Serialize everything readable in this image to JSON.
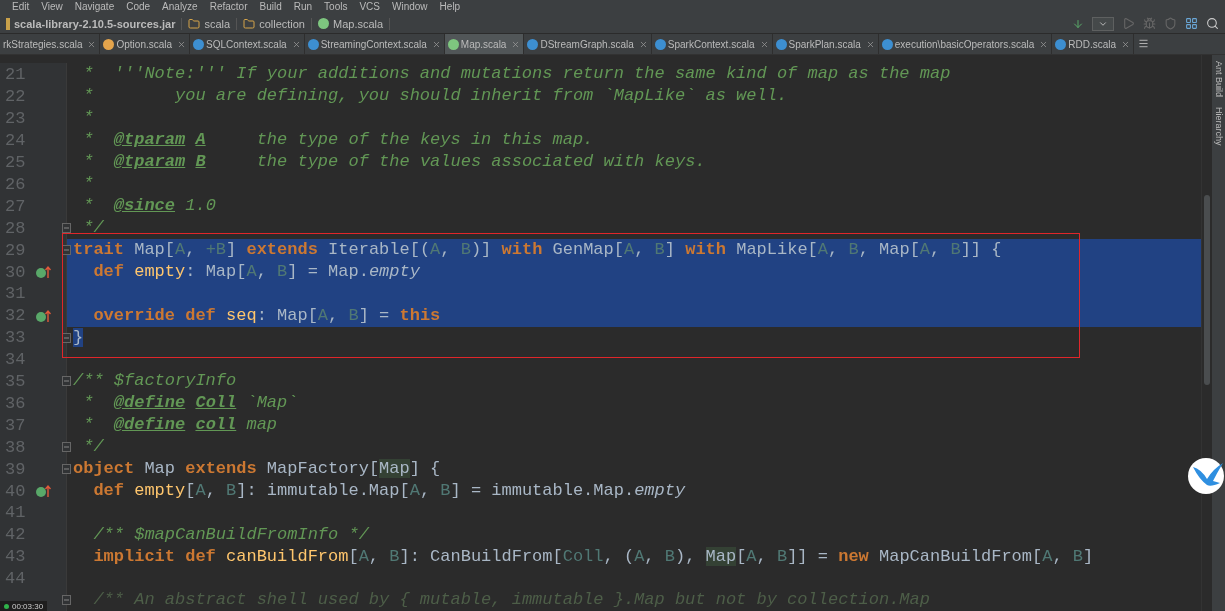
{
  "menu": [
    "Edit",
    "View",
    "Navigate",
    "Code",
    "Analyze",
    "Refactor",
    "Build",
    "Run",
    "Tools",
    "VCS",
    "Window",
    "Help"
  ],
  "breadcrumbs": [
    {
      "kind": "jar",
      "label": "scala-library-2.10.5-sources.jar"
    },
    {
      "kind": "folder",
      "label": "scala"
    },
    {
      "kind": "folder",
      "label": "collection"
    },
    {
      "kind": "trait",
      "label": "Map.scala"
    }
  ],
  "tabs": [
    {
      "kind": "none",
      "label": "rkStrategies.scala",
      "selected": false
    },
    {
      "kind": "object",
      "label": "Option.scala",
      "selected": false
    },
    {
      "kind": "class",
      "label": "SQLContext.scala",
      "selected": false
    },
    {
      "kind": "class",
      "label": "StreamingContext.scala",
      "selected": false
    },
    {
      "kind": "trait",
      "label": "Map.scala",
      "selected": true
    },
    {
      "kind": "class",
      "label": "DStreamGraph.scala",
      "selected": false
    },
    {
      "kind": "class",
      "label": "SparkContext.scala",
      "selected": false
    },
    {
      "kind": "class",
      "label": "SparkPlan.scala",
      "selected": false
    },
    {
      "kind": "class",
      "label": "execution\\basicOperators.scala",
      "selected": false
    },
    {
      "kind": "class",
      "label": "RDD.scala",
      "selected": false
    }
  ],
  "side_tools": [
    "Ant Build",
    "Hierarchy"
  ],
  "lines": [
    {
      "number": "21",
      "marker": false,
      "fold": false,
      "selected": false,
      "tokens": [
        {
          "kind": "doc",
          "text": " *  '''Note:''' If your additions and mutations return the same kind of map as the map"
        }
      ]
    },
    {
      "number": "22",
      "marker": false,
      "fold": false,
      "selected": false,
      "tokens": [
        {
          "kind": "doc",
          "text": " *        you are defining, you should inherit from `MapLike` as well."
        }
      ]
    },
    {
      "number": "23",
      "marker": false,
      "fold": false,
      "selected": false,
      "tokens": [
        {
          "kind": "doc",
          "text": " *"
        }
      ]
    },
    {
      "number": "24",
      "marker": false,
      "fold": false,
      "selected": false,
      "tokens": [
        {
          "kind": "doc",
          "text": " *  "
        },
        {
          "kind": "doctag",
          "text": "@tparam"
        },
        {
          "kind": "doctag",
          "text": " A"
        },
        {
          "kind": "doc",
          "text": "     the type of the keys in this map."
        }
      ]
    },
    {
      "number": "25",
      "marker": false,
      "fold": false,
      "selected": false,
      "tokens": [
        {
          "kind": "doc",
          "text": " *  "
        },
        {
          "kind": "doctag",
          "text": "@tparam"
        },
        {
          "kind": "doctag",
          "text": " B"
        },
        {
          "kind": "doc",
          "text": "     the type of the values associated with keys."
        }
      ]
    },
    {
      "number": "26",
      "marker": false,
      "fold": false,
      "selected": false,
      "tokens": [
        {
          "kind": "doc",
          "text": " *"
        }
      ]
    },
    {
      "number": "27",
      "marker": false,
      "fold": false,
      "selected": false,
      "tokens": [
        {
          "kind": "doc",
          "text": " *  "
        },
        {
          "kind": "doctag",
          "text": "@since"
        },
        {
          "kind": "doc",
          "text": " 1.0"
        }
      ]
    },
    {
      "number": "28",
      "marker": false,
      "fold": true,
      "selected": false,
      "tokens": [
        {
          "kind": "doc",
          "text": " */"
        }
      ]
    },
    {
      "number": "29",
      "marker": false,
      "fold": true,
      "selected": true,
      "tokens": [
        {
          "kind": "kw",
          "text": "trait"
        },
        {
          "kind": "id",
          "text": " Map["
        },
        {
          "kind": "tp",
          "text": "A"
        },
        {
          "kind": "id",
          "text": ", "
        },
        {
          "kind": "tp",
          "text": "+B"
        },
        {
          "kind": "id",
          "text": "] "
        },
        {
          "kind": "kw",
          "text": "extends"
        },
        {
          "kind": "id",
          "text": " Iterable[("
        },
        {
          "kind": "tp",
          "text": "A"
        },
        {
          "kind": "id",
          "text": ", "
        },
        {
          "kind": "tp",
          "text": "B"
        },
        {
          "kind": "id",
          "text": ")] "
        },
        {
          "kind": "kw",
          "text": "with"
        },
        {
          "kind": "id",
          "text": " GenMap["
        },
        {
          "kind": "tp",
          "text": "A"
        },
        {
          "kind": "id",
          "text": ", "
        },
        {
          "kind": "tp",
          "text": "B"
        },
        {
          "kind": "id",
          "text": "] "
        },
        {
          "kind": "kw",
          "text": "with"
        },
        {
          "kind": "id",
          "text": " MapLike["
        },
        {
          "kind": "tp",
          "text": "A"
        },
        {
          "kind": "id",
          "text": ", "
        },
        {
          "kind": "tp",
          "text": "B"
        },
        {
          "kind": "id",
          "text": ", Map["
        },
        {
          "kind": "tp",
          "text": "A"
        },
        {
          "kind": "id",
          "text": ", "
        },
        {
          "kind": "tp",
          "text": "B"
        },
        {
          "kind": "id",
          "text": "]] {"
        }
      ]
    },
    {
      "number": "30",
      "marker": true,
      "fold": false,
      "selected": true,
      "tokens": [
        {
          "kind": "kw",
          "text": "  def"
        },
        {
          "kind": "fn",
          "text": " empty"
        },
        {
          "kind": "id",
          "text": ": Map["
        },
        {
          "kind": "tp",
          "text": "A"
        },
        {
          "kind": "id",
          "text": ", "
        },
        {
          "kind": "tp",
          "text": "B"
        },
        {
          "kind": "id",
          "text": "] = Map."
        },
        {
          "kind": "italic",
          "text": "empty"
        }
      ]
    },
    {
      "number": "31",
      "marker": false,
      "fold": false,
      "selected": true
    },
    {
      "number": "32",
      "marker": true,
      "fold": false,
      "selected": true,
      "tokens": [
        {
          "kind": "kw",
          "text": "  override def"
        },
        {
          "kind": "fn",
          "text": " seq"
        },
        {
          "kind": "id",
          "text": ": Map["
        },
        {
          "kind": "tp",
          "text": "A"
        },
        {
          "kind": "id",
          "text": ", "
        },
        {
          "kind": "tp",
          "text": "B"
        },
        {
          "kind": "id",
          "text": "] = "
        },
        {
          "kind": "kw",
          "text": "this"
        }
      ]
    },
    {
      "number": "33",
      "marker": false,
      "fold": true,
      "selected": false,
      "tokens": [
        {
          "kind": "sel",
          "text": "}"
        }
      ]
    },
    {
      "number": "34",
      "marker": false,
      "fold": false,
      "selected": false
    },
    {
      "number": "35",
      "marker": false,
      "fold": true,
      "selected": false,
      "tokens": [
        {
          "kind": "doc",
          "text": "/** $factoryInfo"
        }
      ]
    },
    {
      "number": "36",
      "marker": false,
      "fold": false,
      "selected": false,
      "tokens": [
        {
          "kind": "doc",
          "text": " *  "
        },
        {
          "kind": "doctag",
          "text": "@define"
        },
        {
          "kind": "doctag",
          "text": " Coll"
        },
        {
          "kind": "doc",
          "text": " `Map`"
        }
      ]
    },
    {
      "number": "37",
      "marker": false,
      "fold": false,
      "selected": false,
      "tokens": [
        {
          "kind": "doc",
          "text": " *  "
        },
        {
          "kind": "doctag",
          "text": "@define"
        },
        {
          "kind": "doctag",
          "text": " coll"
        },
        {
          "kind": "doc",
          "text": " map"
        }
      ]
    },
    {
      "number": "38",
      "marker": false,
      "fold": true,
      "selected": false,
      "tokens": [
        {
          "kind": "doc",
          "text": " */"
        }
      ]
    },
    {
      "number": "39",
      "marker": false,
      "fold": true,
      "selected": false,
      "tokens": [
        {
          "kind": "kw",
          "text": "object"
        },
        {
          "kind": "id",
          "text": " Map "
        },
        {
          "kind": "kw",
          "text": "extends"
        },
        {
          "kind": "id",
          "text": " MapFactory["
        },
        {
          "kind": "match",
          "text": "Map"
        },
        {
          "kind": "id",
          "text": "] {"
        }
      ]
    },
    {
      "number": "40",
      "marker": true,
      "fold": false,
      "selected": false,
      "tokens": [
        {
          "kind": "kw",
          "text": "  def"
        },
        {
          "kind": "fn",
          "text": " empty"
        },
        {
          "kind": "id",
          "text": "["
        },
        {
          "kind": "tp",
          "text": "A"
        },
        {
          "kind": "id",
          "text": ", "
        },
        {
          "kind": "tp",
          "text": "B"
        },
        {
          "kind": "id",
          "text": "]: immutable.Map["
        },
        {
          "kind": "tp",
          "text": "A"
        },
        {
          "kind": "id",
          "text": ", "
        },
        {
          "kind": "tp",
          "text": "B"
        },
        {
          "kind": "id",
          "text": "] = immutable.Map."
        },
        {
          "kind": "italic",
          "text": "empty"
        }
      ]
    },
    {
      "number": "41",
      "marker": false,
      "fold": false,
      "selected": false
    },
    {
      "number": "42",
      "marker": false,
      "fold": false,
      "selected": false,
      "tokens": [
        {
          "kind": "doc",
          "text": "  /** $mapCanBuildFromInfo */"
        }
      ]
    },
    {
      "number": "43",
      "marker": false,
      "fold": false,
      "selected": false,
      "tokens": [
        {
          "kind": "kw",
          "text": "  implicit def"
        },
        {
          "kind": "fn",
          "text": " canBuildFrom"
        },
        {
          "kind": "id",
          "text": "["
        },
        {
          "kind": "tp",
          "text": "A"
        },
        {
          "kind": "id",
          "text": ", "
        },
        {
          "kind": "tp",
          "text": "B"
        },
        {
          "kind": "id",
          "text": "]: CanBuildFrom["
        },
        {
          "kind": "tp",
          "text": "Coll"
        },
        {
          "kind": "id",
          "text": ", ("
        },
        {
          "kind": "tp",
          "text": "A"
        },
        {
          "kind": "id",
          "text": ", "
        },
        {
          "kind": "tp",
          "text": "B"
        },
        {
          "kind": "id",
          "text": "), "
        },
        {
          "kind": "match",
          "text": "Map"
        },
        {
          "kind": "id",
          "text": "["
        },
        {
          "kind": "tp",
          "text": "A"
        },
        {
          "kind": "id",
          "text": ", "
        },
        {
          "kind": "tp",
          "text": "B"
        },
        {
          "kind": "id",
          "text": "]] = "
        },
        {
          "kind": "kw",
          "text": "new"
        },
        {
          "kind": "id",
          "text": " MapCanBuildFrom["
        },
        {
          "kind": "tp",
          "text": "A"
        },
        {
          "kind": "id",
          "text": ", "
        },
        {
          "kind": "tp",
          "text": "B"
        },
        {
          "kind": "id",
          "text": "]"
        }
      ]
    },
    {
      "number": "44",
      "marker": false,
      "fold": false,
      "selected": false
    },
    {
      "marker": false,
      "fold": true,
      "selected": false,
      "tokens": [
        {
          "kind": "faded",
          "text": "  /** An abstract shell used by { mutable, immutable }.Map but not by collection.Map"
        }
      ]
    }
  ],
  "recording_time": "00:03:30"
}
